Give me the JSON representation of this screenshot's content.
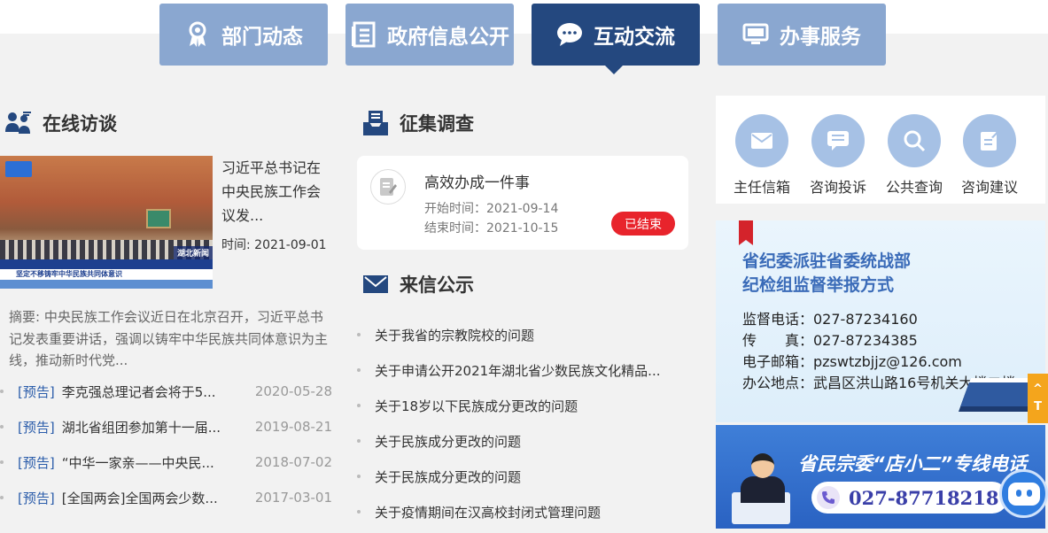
{
  "nav": {
    "tabs": [
      {
        "label": "部门动态",
        "icon": "award-icon",
        "active": false
      },
      {
        "label": "政府信息公开",
        "icon": "document-list-icon",
        "active": false
      },
      {
        "label": "互动交流",
        "icon": "chat-bubble-icon",
        "active": true
      },
      {
        "label": "办事服务",
        "icon": "monitor-icon",
        "active": false
      }
    ]
  },
  "interview": {
    "section_title": "在线访谈",
    "feature": {
      "title": "习近平总书记在中央民族工作会议发...",
      "time": "时间: 2021-09-01",
      "image_caption": "坚定不移铸牢中华民族共同体意识",
      "channel_badge": "湖北新闻"
    },
    "summary": "摘要: 中央民族工作会议近日在北京召开，习近平总书记发表重要讲话，强调以铸牢中华民族共同体意识为主线，推动新时代党...",
    "items": [
      {
        "tag": "[预告]",
        "title": "李克强总理记者会将于5...",
        "date": "2020-05-28"
      },
      {
        "tag": "[预告]",
        "title": "湖北省组团参加第十一届...",
        "date": "2019-08-21"
      },
      {
        "tag": "[预告]",
        "title": "“中华一家亲——中央民...",
        "date": "2018-07-02"
      },
      {
        "tag": "[预告]",
        "title": "[全国两会]全国两会少数...",
        "date": "2017-03-01"
      }
    ]
  },
  "survey": {
    "section_title": "征集调查",
    "card": {
      "title": "高效办成一件事",
      "start": "开始时间：2021-09-14",
      "end": "结束时间：2021-10-15",
      "status": "已结束"
    }
  },
  "letters": {
    "section_title": "来信公示",
    "items": [
      "关于我省的宗教院校的问题",
      "关于申请公开2021年湖北省少数民族文化精品...",
      "关于18岁以下民族成分更改的问题",
      "关于民族成分更改的问题",
      "关于民族成分更改的问题",
      "关于疫情期间在汉高校封闭式管理问题"
    ]
  },
  "quick_links": [
    {
      "label": "主任信箱",
      "icon": "mail-icon"
    },
    {
      "label": "咨询投诉",
      "icon": "message-list-icon"
    },
    {
      "label": "公共查询",
      "icon": "search-icon"
    },
    {
      "label": "咨询建议",
      "icon": "edit-note-icon"
    }
  ],
  "report_banner": {
    "title_line1": "省纪委派驻省委统战部",
    "title_line2": "纪检组监督举报方式",
    "phone": "监督电话：027-87234160",
    "fax": "传　　真：027-87234385",
    "email": "电子邮箱：pzswtzbjjz@126.com",
    "address": "办公地点：武昌区洪山路16号机关大楼二楼"
  },
  "hotline_banner": {
    "title": "省民宗委“店小二”专线电话",
    "phone": "027-87718218"
  },
  "side_tab": "T",
  "colors": {
    "nav_active": "#24487f",
    "nav_inactive": "#8aa7d0",
    "status_red": "#e8242c",
    "tag_blue": "#2a5caa",
    "quick_circle": "#a6c1e5"
  }
}
